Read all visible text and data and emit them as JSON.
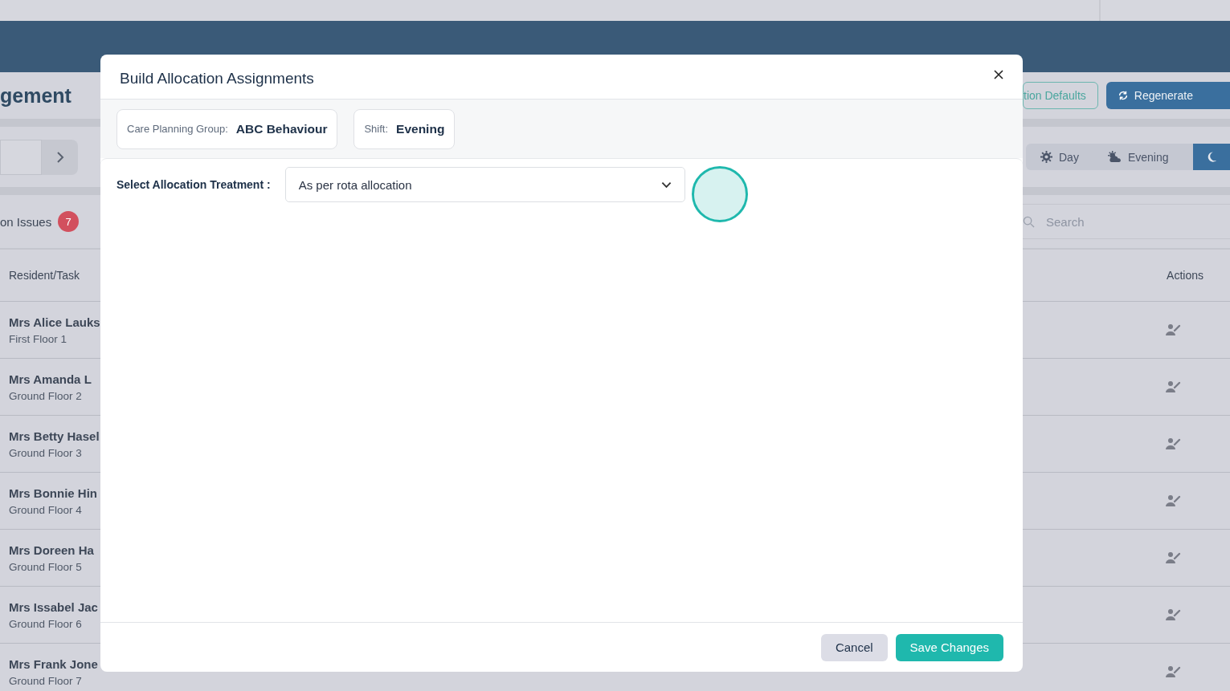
{
  "page": {
    "title": "gement",
    "header_buttons": [
      {
        "label": "tion Defaults",
        "kind": "outline"
      },
      {
        "label": "Regenerate",
        "kind": "primary"
      }
    ],
    "shift_tabs": [
      {
        "label": "Day",
        "kind": "day",
        "selected": false
      },
      {
        "label": "Evening",
        "kind": "evening",
        "selected": false
      },
      {
        "kind": "night",
        "selected": true
      }
    ],
    "issues": {
      "label": "on Issues",
      "count": "7"
    },
    "search": {
      "placeholder": "Search"
    },
    "table": {
      "columns": [
        "Resident/Task",
        "Actions"
      ],
      "rows": [
        {
          "name": "Mrs Alice Lauks",
          "location": "First Floor 1"
        },
        {
          "name": "Mrs Amanda L",
          "location": "Ground Floor 2"
        },
        {
          "name": "Mrs Betty Hasel",
          "location": "Ground Floor 3"
        },
        {
          "name": "Mrs Bonnie Hin",
          "location": "Ground Floor 4"
        },
        {
          "name": "Mrs Doreen Ha",
          "location": "Ground Floor 5"
        },
        {
          "name": "Mrs Issabel Jac",
          "location": "Ground Floor 6"
        },
        {
          "name": "Mrs Frank Jone",
          "location": "Ground Floor 7"
        }
      ]
    }
  },
  "modal": {
    "title": "Build Allocation Assignments",
    "chips": [
      {
        "label": "Care Planning Group:",
        "value": "ABC Behaviour"
      },
      {
        "label": "Shift:",
        "value": "Evening"
      }
    ],
    "field": {
      "label": "Select Allocation Treatment :",
      "value": "As per rota allocation"
    },
    "buttons": [
      {
        "label": "Cancel",
        "kind": "secondary"
      },
      {
        "label": "Save Changes",
        "kind": "primary"
      }
    ]
  }
}
